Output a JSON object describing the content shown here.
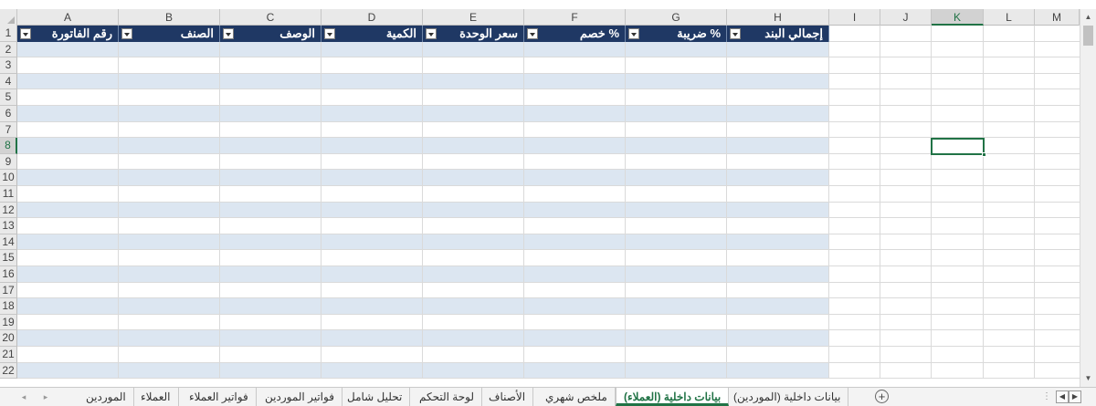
{
  "columns": [
    "A",
    "B",
    "C",
    "D",
    "E",
    "F",
    "G",
    "H",
    "I",
    "J",
    "K",
    "L",
    "M"
  ],
  "active_column": "K",
  "rows": [
    "1",
    "2",
    "3",
    "4",
    "5",
    "6",
    "7",
    "8",
    "9",
    "10",
    "11",
    "12",
    "13",
    "14",
    "15",
    "16",
    "17",
    "18",
    "19",
    "20",
    "21",
    "22"
  ],
  "active_row": "8",
  "table_headers": [
    "رقم الفاتورة",
    "الصنف",
    "الوصف",
    "الكمية",
    "سعر الوحدة",
    "خصم %",
    "ضريبة %",
    "إجمالي البند"
  ],
  "sheet_tabs": [
    "الموردين",
    "العملاء",
    "فواتير العملاء",
    "فواتير الموردين",
    "تحليل شامل",
    "لوحة التحكم",
    "الأصناف",
    "ملخص شهري",
    "بيانات داخلية (العملاء)",
    "بيانات داخلية (الموردين)"
  ],
  "active_tab": "بيانات داخلية (العملاء)",
  "colors": {
    "table_header_bg": "#1f3864",
    "band_fill": "#dce6f1",
    "accent": "#217346"
  },
  "icons": {
    "filter": "filter-dropdown-icon",
    "add_sheet": "plus-circle-icon",
    "scroll_up": "triangle-up-icon",
    "scroll_down": "triangle-down-icon"
  }
}
